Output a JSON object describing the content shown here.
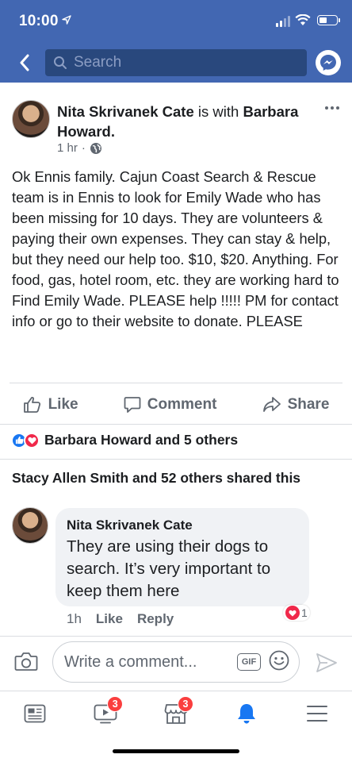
{
  "status": {
    "time": "10:00"
  },
  "nav": {
    "search_placeholder": "Search"
  },
  "post": {
    "author": "Nita Skrivanek Cate",
    "with_word": "is with",
    "tagged": "Barbara Howard.",
    "time": "1 hr",
    "body": "Ok Ennis family.   Cajun Coast Search & Rescue team is in Ennis to look for Emily Wade who has been missing for 10 days.  They are volunteers & paying their own expenses.  They can stay & help, but they need our help too.  $10, $20.  Anything.  For food, gas, hotel room, etc.  they are working hard to Find Emily Wade.  PLEASE help !!!!! PM for contact info or go to their website to donate.  PLEASE",
    "actions": {
      "like": "Like",
      "comment": "Comment",
      "share": "Share"
    },
    "reactions_text": "Barbara Howard and 5 others",
    "shares_text": "Stacy Allen Smith and 52 others shared this"
  },
  "comment": {
    "author": "Nita Skrivanek Cate",
    "text": "They are using their dogs to search.  It’s very important to keep them here",
    "time": "1h",
    "like": "Like",
    "reply": "Reply",
    "reaction_count": "1"
  },
  "composer": {
    "placeholder": "Write a comment...",
    "gif": "GIF"
  },
  "tabbar": {
    "video_badge": "3",
    "marketplace_badge": "3"
  },
  "colors": {
    "brand": "#4267b2",
    "search_bg": "#29487d",
    "active_tab": "#1877f2",
    "badge": "#fa3e3e"
  }
}
